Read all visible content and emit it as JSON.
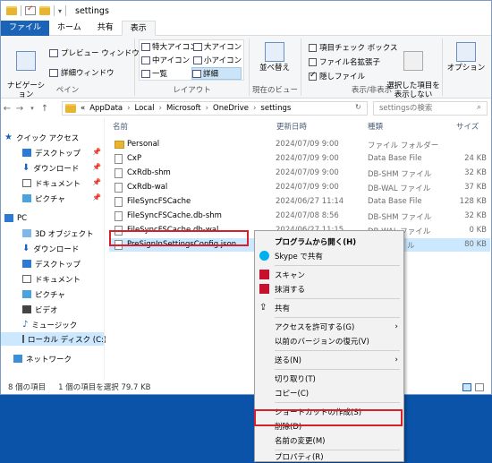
{
  "window": {
    "title": "settings"
  },
  "tabs": {
    "file": "ファイル",
    "home": "ホーム",
    "share": "共有",
    "view": "表示"
  },
  "ribbon": {
    "nav_pane": "ナビゲーション\nウィンドウ",
    "preview_pane": "プレビュー ウィンドウ",
    "details_pane": "詳細ウィンドウ",
    "pane_group": "ペイン",
    "layout": {
      "extra_large": "特大アイコン",
      "large": "大アイコン",
      "medium": "中アイコン",
      "small": "小アイコン",
      "list": "一覧",
      "details": "詳細"
    },
    "layout_group": "レイアウト",
    "sort_by": "並べ替え",
    "current_view_group": "現在のビュー",
    "item_checkboxes": "項目チェック ボックス",
    "file_extensions": "ファイル名拡張子",
    "hidden_items": "隠しファイル",
    "hide_selected": "選択した項目を\n表示しない",
    "show_hide_group": "表示/非表示",
    "options": "オプション"
  },
  "address": {
    "crumbs": [
      "«",
      "AppData",
      "Local",
      "Microsoft",
      "OneDrive",
      "settings"
    ],
    "search_placeholder": "settingsの検索"
  },
  "nav": {
    "quick_access": "クイック アクセス",
    "desktop": "デスクトップ",
    "downloads": "ダウンロード",
    "documents": "ドキュメント",
    "pictures": "ピクチャ",
    "pc": "PC",
    "objects3d": "3D オブジェクト",
    "downloads2": "ダウンロード",
    "desktop2": "デスクトップ",
    "documents2": "ドキュメント",
    "pictures2": "ピクチャ",
    "videos": "ビデオ",
    "music": "ミュージック",
    "local_disk": "ローカル ディスク (C:)",
    "network": "ネットワーク"
  },
  "columns": {
    "name": "名前",
    "date": "更新日時",
    "type": "種類",
    "size": "サイズ"
  },
  "files": [
    {
      "name": "Personal",
      "date": "2024/07/09 9:00",
      "type": "ファイル フォルダー",
      "size": ""
    },
    {
      "name": "CxP",
      "date": "2024/07/09 9:00",
      "type": "Data Base File",
      "size": "24 KB"
    },
    {
      "name": "CxRdb-shm",
      "date": "2024/07/09 9:00",
      "type": "DB-SHM ファイル",
      "size": "32 KB"
    },
    {
      "name": "CxRdb-wal",
      "date": "2024/07/09 9:00",
      "type": "DB-WAL ファイル",
      "size": "37 KB"
    },
    {
      "name": "FileSyncFSCache",
      "date": "2024/06/27 11:14",
      "type": "Data Base File",
      "size": "128 KB"
    },
    {
      "name": "FileSyncFSCache.db-shm",
      "date": "2024/07/08 8:56",
      "type": "DB-SHM ファイル",
      "size": "32 KB"
    },
    {
      "name": "FileSyncFSCache.db-wal",
      "date": "2024/06/27 11:15",
      "type": "DB-WAL ファイル",
      "size": "0 KB"
    },
    {
      "name": "PreSignInSettingsConfig.json",
      "date": "",
      "type": "ル",
      "size": "80 KB"
    }
  ],
  "status": {
    "count": "8 個の項目",
    "selected": "1 個の項目を選択  79.7 KB"
  },
  "context_menu": {
    "open_with": "プログラムから開く(H)",
    "skype_share": "Skype で共有",
    "scan": "スキャン",
    "shred": "抹消する",
    "share": "共有",
    "give_access": "アクセスを許可する(G)",
    "restore_prev": "以前のバージョンの復元(V)",
    "send_to": "送る(N)",
    "cut": "切り取り(T)",
    "copy": "コピー(C)",
    "create_shortcut": "ショートカットの作成(S)",
    "delete": "削除(D)",
    "rename": "名前の変更(M)",
    "properties": "プロパティ(R)"
  },
  "colors": {
    "highlight": "#d8202a",
    "accent": "#1a63b6"
  }
}
